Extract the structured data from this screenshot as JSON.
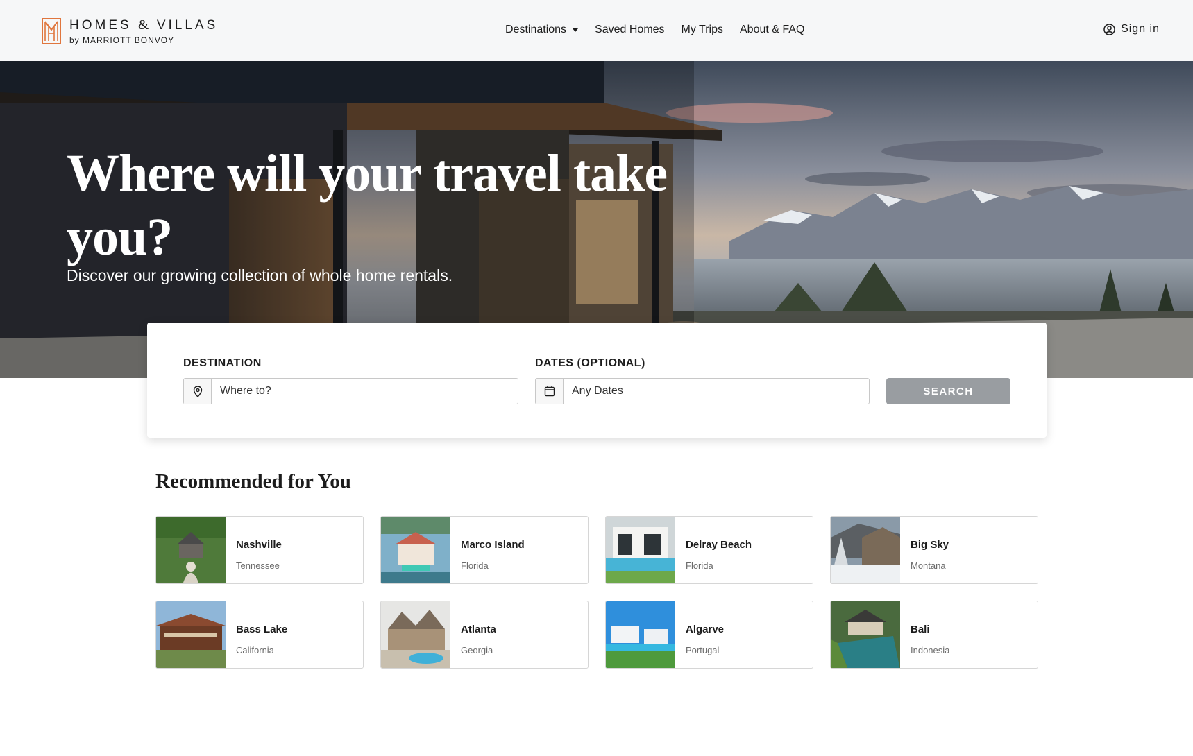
{
  "brand": {
    "name_part1": "HOMES",
    "name_amp": "&",
    "name_part2": "VILLAS",
    "tagline": "by MARRIOTT BONVOY",
    "accent_color": "#e0763e"
  },
  "nav": {
    "items": [
      {
        "label": "Destinations",
        "has_dropdown": true
      },
      {
        "label": "Saved Homes",
        "has_dropdown": false
      },
      {
        "label": "My Trips",
        "has_dropdown": false
      },
      {
        "label": "About & FAQ",
        "has_dropdown": false
      }
    ],
    "sign_in": "Sign in"
  },
  "hero": {
    "title": "Where will your travel take you?",
    "subtitle": "Discover our growing collection of whole home rentals."
  },
  "search": {
    "destination_label": "DESTINATION",
    "destination_placeholder": "Where to?",
    "destination_icon": "map-pin-icon",
    "dates_label": "DATES (OPTIONAL)",
    "dates_placeholder": "Any Dates",
    "dates_icon": "calendar-icon",
    "button_label": "SEARCH"
  },
  "recommended": {
    "title": "Recommended for You",
    "items": [
      {
        "city": "Nashville",
        "region": "Tennessee"
      },
      {
        "city": "Marco Island",
        "region": "Florida"
      },
      {
        "city": "Delray Beach",
        "region": "Florida"
      },
      {
        "city": "Big Sky",
        "region": "Montana"
      },
      {
        "city": "Bass Lake",
        "region": "California"
      },
      {
        "city": "Atlanta",
        "region": "Georgia"
      },
      {
        "city": "Algarve",
        "region": "Portugal"
      },
      {
        "city": "Bali",
        "region": "Indonesia"
      }
    ]
  }
}
